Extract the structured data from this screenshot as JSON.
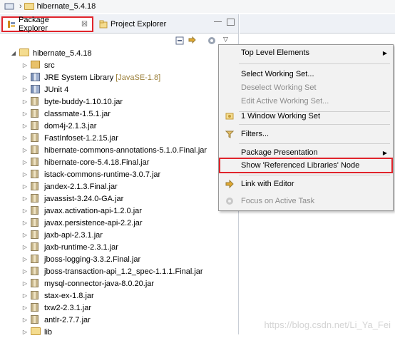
{
  "breadcrumb": {
    "project": "hibernate_5.4.18"
  },
  "tabs": [
    {
      "label": "Package Explorer",
      "active": true,
      "close": "☒"
    },
    {
      "label": "Project Explorer",
      "active": false
    }
  ],
  "tree": {
    "root": "hibernate_5.4.18",
    "items": [
      {
        "label": "src",
        "icon": "source-folder-icon"
      },
      {
        "label": "JRE System Library",
        "decor": "[JavaSE-1.8]",
        "icon": "library-icon"
      },
      {
        "label": "JUnit 4",
        "icon": "library-icon"
      },
      {
        "label": "byte-buddy-1.10.10.jar",
        "icon": "jar-icon"
      },
      {
        "label": "classmate-1.5.1.jar",
        "icon": "jar-icon"
      },
      {
        "label": "dom4j-2.1.3.jar",
        "icon": "jar-icon"
      },
      {
        "label": "FastInfoset-1.2.15.jar",
        "icon": "jar-icon"
      },
      {
        "label": "hibernate-commons-annotations-5.1.0.Final.jar",
        "icon": "jar-icon"
      },
      {
        "label": "hibernate-core-5.4.18.Final.jar",
        "icon": "jar-icon"
      },
      {
        "label": "istack-commons-runtime-3.0.7.jar",
        "icon": "jar-icon"
      },
      {
        "label": "jandex-2.1.3.Final.jar",
        "icon": "jar-icon"
      },
      {
        "label": "javassist-3.24.0-GA.jar",
        "icon": "jar-icon"
      },
      {
        "label": "javax.activation-api-1.2.0.jar",
        "icon": "jar-icon"
      },
      {
        "label": "javax.persistence-api-2.2.jar",
        "icon": "jar-icon"
      },
      {
        "label": "jaxb-api-2.3.1.jar",
        "icon": "jar-icon"
      },
      {
        "label": "jaxb-runtime-2.3.1.jar",
        "icon": "jar-icon"
      },
      {
        "label": "jboss-logging-3.3.2.Final.jar",
        "icon": "jar-icon"
      },
      {
        "label": "jboss-transaction-api_1.2_spec-1.1.1.Final.jar",
        "icon": "jar-icon"
      },
      {
        "label": "mysql-connector-java-8.0.20.jar",
        "icon": "jar-icon"
      },
      {
        "label": "stax-ex-1.8.jar",
        "icon": "jar-icon"
      },
      {
        "label": "txw2-2.3.1.jar",
        "icon": "jar-icon"
      },
      {
        "label": "antlr-2.7.7.jar",
        "icon": "jar-icon"
      },
      {
        "label": "lib",
        "icon": "folder-icon"
      }
    ]
  },
  "menu": {
    "items": [
      {
        "label": "Top Level Elements",
        "submenu": true
      },
      {
        "label": "Select Working Set..."
      },
      {
        "label": "Deselect Working Set",
        "disabled": true
      },
      {
        "label": "Edit Active Working Set...",
        "disabled": true
      },
      {
        "label": "1 Window Working Set",
        "icon": "working-set-icon"
      },
      {
        "label": "Filters...",
        "icon": "filter-icon"
      },
      {
        "label": "Package Presentation",
        "submenu": true
      },
      {
        "label": "Show 'Referenced Libraries' Node",
        "highlight": true
      },
      {
        "label": "Link with Editor",
        "icon": "link-icon"
      },
      {
        "label": "Focus on Active Task",
        "icon": "task-icon",
        "disabled": true
      }
    ]
  },
  "watermark": "https://blog.csdn.net/Li_Ya_Fei",
  "colors": {
    "highlight_border": "#e0242b",
    "menu_bg": "#f2f2f2"
  }
}
